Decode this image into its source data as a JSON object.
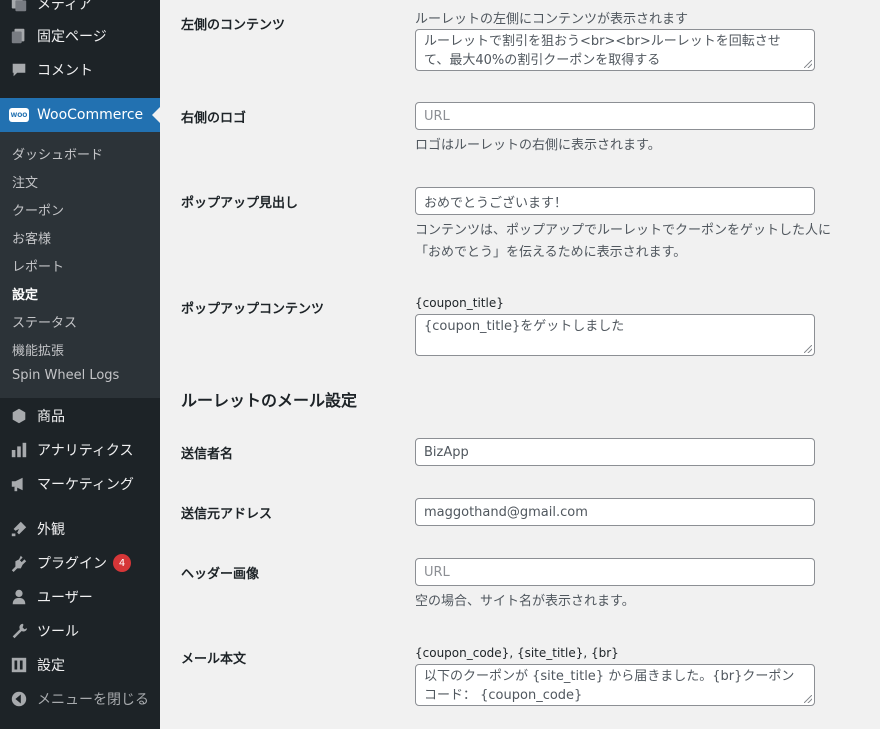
{
  "sidebar": {
    "top_items": [
      {
        "label": "メディア",
        "icon": "media-icon"
      },
      {
        "label": "固定ページ",
        "icon": "page-icon"
      },
      {
        "label": "コメント",
        "icon": "comment-icon"
      }
    ],
    "woocommerce": {
      "label": "WooCommerce",
      "logo_text": "WOO"
    },
    "submenu": [
      {
        "label": "ダッシュボード"
      },
      {
        "label": "注文"
      },
      {
        "label": "クーポン"
      },
      {
        "label": "お客様"
      },
      {
        "label": "レポート"
      },
      {
        "label": "設定",
        "current": true
      },
      {
        "label": "ステータス"
      },
      {
        "label": "機能拡張"
      },
      {
        "label": "Spin Wheel Logs"
      }
    ],
    "lower_items": [
      {
        "label": "商品",
        "icon": "product-icon"
      },
      {
        "label": "アナリティクス",
        "icon": "analytics-icon"
      },
      {
        "label": "マーケティング",
        "icon": "megaphone-icon"
      },
      {
        "label": "外観",
        "icon": "appearance-icon"
      },
      {
        "label": "プラグイン",
        "icon": "plugin-icon",
        "badge": "4"
      },
      {
        "label": "ユーザー",
        "icon": "user-icon"
      },
      {
        "label": "ツール",
        "icon": "wrench-icon"
      },
      {
        "label": "設定",
        "icon": "settings-icon"
      }
    ],
    "collapse": "メニューを閉じる"
  },
  "form": {
    "left_content": {
      "label": "左側のコンテンツ",
      "description": "ルーレットの左側にコンテンツが表示されます",
      "value": "ルーレットで割引を狙おう<br><br>ルーレットを回転させて、最大40%の割引クーポンを取得する"
    },
    "right_logo": {
      "label": "右側のロゴ",
      "placeholder": "URL",
      "description": "ロゴはルーレットの右側に表示されます。"
    },
    "popup_heading": {
      "label": "ポップアップ見出し",
      "value": "おめでとうございます！",
      "description_line1": "コンテンツは、ポップアップでルーレットでクーポンをゲットした人に",
      "description_line2": "「おめでとう」を伝えるために表示されます。"
    },
    "popup_content": {
      "label": "ポップアップコンテンツ",
      "hint": "{coupon_title}",
      "value": "{coupon_title}をゲットしました"
    },
    "mail_section_title": "ルーレットのメール設定",
    "sender_name": {
      "label": "送信者名",
      "value": "BizApp"
    },
    "sender_address": {
      "label": "送信元アドレス",
      "value": "maggothand@gmail.com"
    },
    "header_image": {
      "label": "ヘッダー画像",
      "placeholder": "URL",
      "description": "空の場合、サイト名が表示されます。"
    },
    "mail_body": {
      "label": "メール本文",
      "hint": "{coupon_code}, {site_title}, {br}",
      "value": "以下のクーポンが {site_title} から届きました。{br}クーポンコード： {coupon_code}"
    }
  },
  "colors": {
    "sidebar_bg": "#1d2327",
    "submenu_bg": "#2c3338",
    "active_bg": "#2271b1",
    "badge_bg": "#d63638"
  }
}
